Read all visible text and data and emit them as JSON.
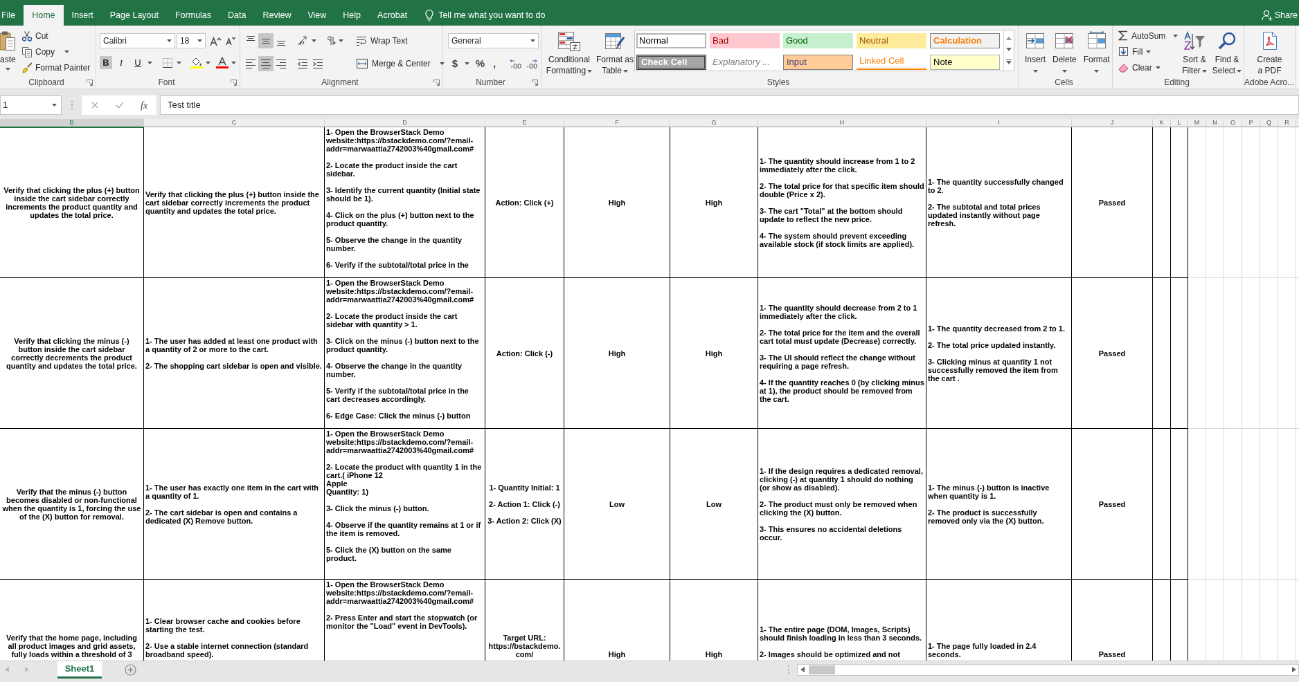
{
  "menu_tabs": [
    {
      "label": "File",
      "selected": false
    },
    {
      "label": "Home",
      "selected": true
    },
    {
      "label": "Insert",
      "selected": false
    },
    {
      "label": "Page Layout",
      "selected": false
    },
    {
      "label": "Formulas",
      "selected": false
    },
    {
      "label": "Data",
      "selected": false
    },
    {
      "label": "Review",
      "selected": false
    },
    {
      "label": "View",
      "selected": false
    },
    {
      "label": "Help",
      "selected": false
    },
    {
      "label": "Acrobat",
      "selected": false
    }
  ],
  "tell_me": {
    "label": "Tell me what you want to do"
  },
  "share": {
    "label": "Share"
  },
  "ribbon": {
    "clipboard": {
      "title": "Clipboard",
      "paste": "aste",
      "cut": "Cut",
      "copy": "Copy",
      "format_painter": "Format Painter"
    },
    "font": {
      "title": "Font",
      "font_name": "Calibri",
      "font_size": "18",
      "format_buttons": [
        {
          "kind": "bold",
          "label": "B",
          "selected": true
        },
        {
          "kind": "italic",
          "label": "I",
          "selected": false
        },
        {
          "kind": "underline",
          "label": "U",
          "selected": false
        }
      ]
    },
    "alignment": {
      "title": "Alignment",
      "vertical": [
        {
          "kind": "top",
          "selected": false
        },
        {
          "kind": "middle",
          "selected": true
        },
        {
          "kind": "bottom",
          "selected": false
        }
      ],
      "horizontal": [
        {
          "kind": "left",
          "selected": false
        },
        {
          "kind": "center",
          "selected": true
        },
        {
          "kind": "right",
          "selected": false
        }
      ],
      "wrap_text": "Wrap Text",
      "merge": "Merge & Center"
    },
    "number": {
      "title": "Number",
      "format": "General",
      "buttons": [
        {
          "kind": "currency",
          "label": "$"
        },
        {
          "kind": "percent",
          "label": "%"
        },
        {
          "kind": "comma",
          "label": ","
        }
      ]
    },
    "styles": {
      "title": "Styles",
      "conditional_formatting": "Conditional Formatting",
      "format_as_table": "Format as Table",
      "cell_styles": [
        {
          "kind": "normal",
          "label": "Normal",
          "selected": true
        },
        {
          "kind": "bad",
          "label": "Bad",
          "selected": false
        },
        {
          "kind": "good",
          "label": "Good",
          "selected": false
        },
        {
          "kind": "neutral",
          "label": "Neutral",
          "selected": false
        },
        {
          "kind": "calculation",
          "label": "Calculation",
          "selected": false
        },
        {
          "kind": "check",
          "label": "Check Cell",
          "selected": false
        },
        {
          "kind": "explanatory",
          "label": "Explanatory ...",
          "selected": false
        },
        {
          "kind": "input",
          "label": "Input",
          "selected": false
        },
        {
          "kind": "linked",
          "label": "Linked Cell",
          "selected": false
        },
        {
          "kind": "note",
          "label": "Note",
          "selected": false
        }
      ]
    },
    "cells": {
      "title": "Cells",
      "buttons": [
        {
          "kind": "insert",
          "label": "Insert"
        },
        {
          "kind": "delete",
          "label": "Delete"
        },
        {
          "kind": "format",
          "label": "Format"
        }
      ]
    },
    "editing": {
      "title": "Editing",
      "autosum": "AutoSum",
      "fill": "Fill",
      "clear": "Clear",
      "sort_filter": "Sort & Filter",
      "find_select": "Find & Select"
    },
    "acrobat": {
      "title": "Adobe Acro...",
      "create_pdf": "Create a PDF"
    }
  },
  "formula_bar": {
    "name_box": "1",
    "fx": "fx",
    "formula": "Test title"
  },
  "table": {
    "columns": [
      {
        "letter": "B",
        "selected": true
      },
      {
        "letter": "C",
        "selected": false
      },
      {
        "letter": "D",
        "selected": false
      },
      {
        "letter": "E",
        "selected": false
      },
      {
        "letter": "F",
        "selected": false
      },
      {
        "letter": "G",
        "selected": false
      },
      {
        "letter": "H",
        "selected": false
      },
      {
        "letter": "I",
        "selected": false
      },
      {
        "letter": "J",
        "selected": false
      },
      {
        "letter": "K",
        "selected": false
      },
      {
        "letter": "L",
        "selected": false
      },
      {
        "letter": "M",
        "selected": false
      },
      {
        "letter": "N",
        "selected": false
      },
      {
        "letter": "O",
        "selected": false
      },
      {
        "letter": "P",
        "selected": false
      },
      {
        "letter": "Q",
        "selected": false
      },
      {
        "letter": "R",
        "selected": false
      }
    ],
    "rows": [
      {
        "cells": [
          "Verify that clicking the plus (+) button inside the cart sidebar correctly increments the product quantity and updates the total price.",
          "Verify that clicking the plus (+) button inside the cart sidebar correctly increments the product quantity and updates the total price.",
          "1- Open the BrowserStack Demo website:https://bstackdemo.com/?email-addr=marwaattia2742003%40gmail.com#\n\n2- Locate the product inside the cart sidebar.\n\n3- Identify the current quantity (Initial state should be 1).\n\n4- Click on the plus (+) button next to the product quantity.\n\n5- Observe the change in the quantity number.\n\n6- Verify if the subtotal/total price in the",
          "Action: Click (+)",
          "High",
          "High",
          "1- The quantity should increase from 1 to 2 immediately after the click.\n\n2- The total price for that specific item should double (Price x 2).\n\n3- The cart \"Total\" at the bottom should update to reflect the new price.\n\n4- The system should prevent exceeding available stock (if stock limits are applied).",
          "1- The quantity successfully changed to 2.\n\n2- The subtotal and total prices updated instantly without page refresh.",
          "Passed"
        ]
      },
      {
        "cells": [
          "Verify that clicking the minus (-) button inside the cart sidebar correctly decrements the product quantity and updates the total price.",
          "1- The user has added at least one product with a quantity of 2 or more to the cart.\n\n2- The shopping cart sidebar is open and visible.",
          "1- Open the BrowserStack Demo website:https://bstackdemo.com/?email-addr=marwaattia2742003%40gmail.com#\n\n2- Locate the product inside the cart sidebar with quantity > 1.\n\n3- Click on the minus (-) button next to the product quantity.\n\n4- Observe the change in the quantity number.\n\n5- Verify if the subtotal/total price in the cart decreases accordingly.\n\n6- Edge Case: Click the minus (-) button",
          "Action: Click (-)",
          "High",
          "High",
          "1- The quantity should decrease from 2 to 1 immediately after the click.\n\n2- The total price for the item and the overall cart total must update (Decrease) correctly.\n\n3- The UI should reflect the change without requiring a page refresh.\n\n4- If the quantity reaches 0 (by clicking minus at 1), the product should be removed from the cart.",
          "1- The quantity decreased from 2 to 1.\n\n2- The total price updated instantly.\n\n3- Clicking minus at quantity 1 not successfully removed the item from the cart .",
          "Passed"
        ]
      },
      {
        "cells": [
          "Verify that the minus (-) button becomes disabled or non-functional when the quantity is 1, forcing the use of the (X) button for removal.",
          "1- The user has exactly one item in the cart with a quantity of 1.\n\n2- The cart sidebar is open and contains a dedicated (X) Remove button.",
          "1- Open the BrowserStack Demo website:https://bstackdemo.com/?email-addr=marwaattia2742003%40gmail.com#\n\n2- Locate the product with quantity 1 in the cart.( iPhone 12\nApple\nQuantity: 1)\n\n3- Click the minus (-) button.\n\n4- Observe if the quantity remains at 1 or if the item is removed.\n\n5- Click the (X) button on the same product.",
          "1- Quantity Initial: 1\n\n2- Action 1: Click (-)\n\n3- Action 2: Click (X)",
          "Low",
          "Low",
          "1- If the design requires a dedicated removal, clicking (-) at quantity 1 should do nothing (or show as disabled).\n\n2- The product must only be removed when clicking the (X) button.\n\n3- This ensures no accidental deletions occur.",
          "1- The minus (-) button is inactive when quantity is 1.\n\n2- The product is successfully removed only via the (X) button.",
          "Passed"
        ]
      },
      {
        "cells": [
          "Verify that the home page, including all product images and grid assets, fully loads within a threshold of 3",
          "1- Clear browser cache and cookies before starting the test.\n\n2- Use a stable internet connection (standard broadband speed).",
          "1- Open the BrowserStack Demo website:https://bstackdemo.com/?email-addr=marwaattia2742003%40gmail.com#\n\n2- Press Enter and start the stopwatch (or monitor the \"Load\" event in DevTools).",
          "Target URL: https://bstackdemo.com/",
          "High",
          "High",
          "1- The entire page (DOM, Images, Scripts) should finish loading in less than 3 seconds.\n\n2- Images should be optimized and not",
          "1- The page fully loaded in 2.4 seconds.",
          "Passed"
        ]
      }
    ]
  },
  "sheet_tabs": [
    {
      "label": "Sheet1",
      "selected": true
    }
  ]
}
